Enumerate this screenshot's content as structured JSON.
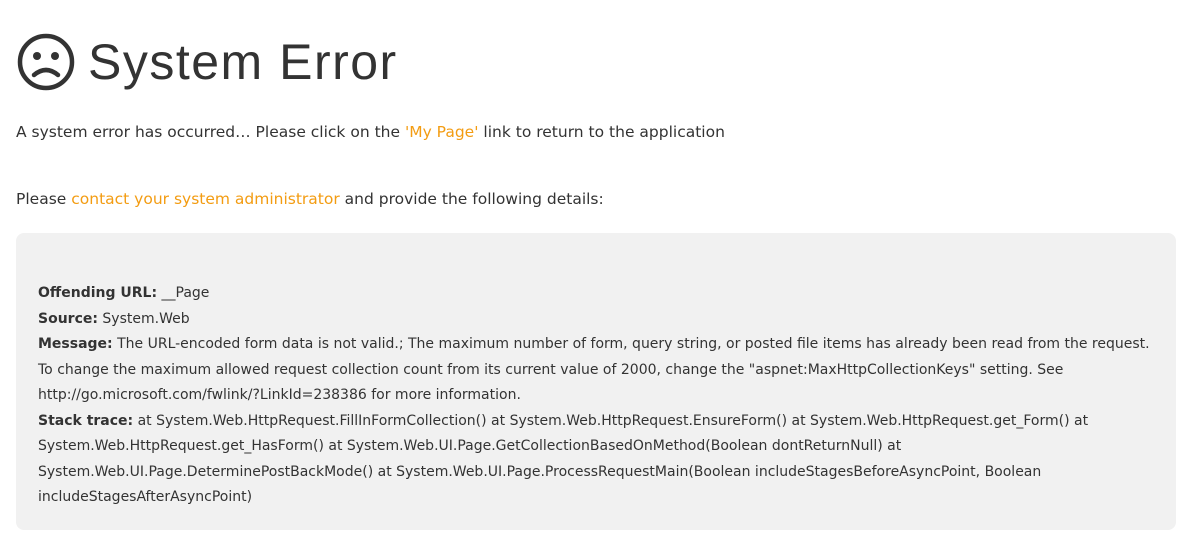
{
  "header": {
    "icon": "sad-face-icon",
    "title": "System Error"
  },
  "message": {
    "prefix": "A system error has occurred… Please click on the ",
    "link": "'My Page'",
    "suffix": " link to return to the application"
  },
  "contact": {
    "prefix": "Please ",
    "link": "contact your system administrator",
    "suffix": " and provide the following details:"
  },
  "details": {
    "url_label": "Offending URL:",
    "url_value": " __Page",
    "source_label": "Source:",
    "source_value": " System.Web",
    "message_label": "Message:",
    "message_value": " The URL-encoded form data is not valid.; The maximum number of form, query string, or posted file items has already been read from the request. To change the maximum allowed request collection count from its current value of 2000, change the \"aspnet:MaxHttpCollectionKeys\" setting. See http://go.microsoft.com/fwlink/?LinkId=238386 for more information.",
    "stack_label": "Stack trace:",
    "stack_value": " at System.Web.HttpRequest.FillInFormCollection() at System.Web.HttpRequest.EnsureForm() at System.Web.HttpRequest.get_Form() at System.Web.HttpRequest.get_HasForm() at System.Web.UI.Page.GetCollectionBasedOnMethod(Boolean dontReturnNull) at System.Web.UI.Page.DeterminePostBackMode() at System.Web.UI.Page.ProcessRequestMain(Boolean includeStagesBeforeAsyncPoint, Boolean includeStagesAfterAsyncPoint)"
  },
  "colors": {
    "link": "#f39c12",
    "panel": "#f1f1f1",
    "text": "#333333"
  }
}
